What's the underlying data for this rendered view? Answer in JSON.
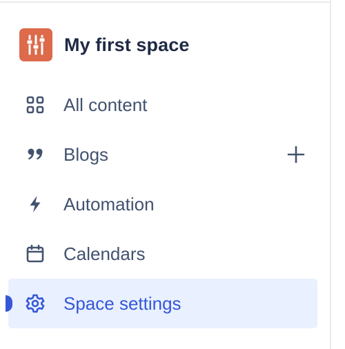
{
  "space": {
    "title": "My first space",
    "avatar_icon": "sliders-icon",
    "avatar_color": "#dc6a4b"
  },
  "nav": {
    "items": [
      {
        "label": "All content",
        "icon": "grid-icon"
      },
      {
        "label": "Blogs",
        "icon": "quote-icon",
        "action_icon": "plus-icon"
      },
      {
        "label": "Automation",
        "icon": "lightning-icon"
      },
      {
        "label": "Calendars",
        "icon": "calendar-icon"
      },
      {
        "label": "Space settings",
        "icon": "gear-icon",
        "active": true
      }
    ]
  },
  "colors": {
    "text": "#42526e",
    "title": "#1f2a44",
    "accent": "#3557d8",
    "active_bg": "#e9f0ff"
  }
}
